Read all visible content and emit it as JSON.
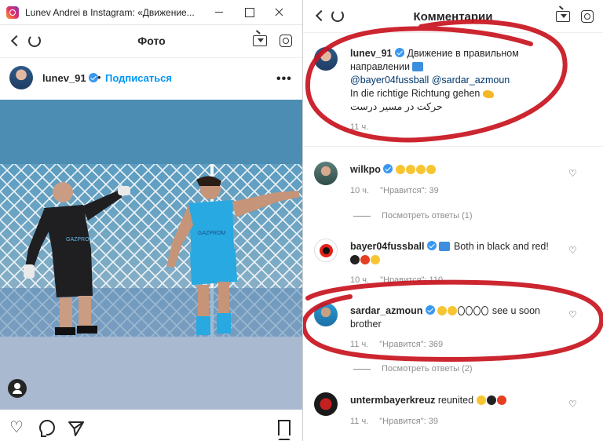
{
  "left_window": {
    "title": "Lunev Andrei в Instagram: «Движение...",
    "nav_title": "Фото",
    "post": {
      "username": "lunev_91",
      "follow_label": "Подписаться",
      "more_label": "•••",
      "photo_sign": "GAZPROM"
    }
  },
  "right_window": {
    "nav_title": "Комментарии",
    "caption": {
      "username": "lunev_91",
      "line1": " Движение в правильном направлении",
      "line2": "@bayer04fussball @sardar_azmoun",
      "line3": "In die richtige Richtung gehen",
      "line4": "حرکت در مسیر درست",
      "time": "11 ч."
    },
    "comments": [
      {
        "username": "wilkpo",
        "text": "",
        "time": "10 ч.",
        "likes": "\"Нравится\": 39",
        "replies": "Посмотреть ответы (1)"
      },
      {
        "username": "bayer04fussball",
        "text": " Both in black and red!",
        "time": "10 ч.",
        "likes": "\"Нравится\": 110",
        "replies": ""
      },
      {
        "username": "sardar_azmoun",
        "text": " see u soon",
        "text2": "brother",
        "time": "11 ч.",
        "likes": "\"Нравится\": 369",
        "replies": "Посмотреть ответы (2)"
      },
      {
        "username": "untermbayerkreuz",
        "text": " reunited",
        "time": "11 ч.",
        "likes": "\"Нравится\": 39",
        "replies": ""
      }
    ]
  },
  "icons": [
    "instagram-app-icon",
    "back-icon",
    "reload-icon",
    "igtv-icon",
    "instagram-icon",
    "verified-icon",
    "heart-icon",
    "comment-icon",
    "share-icon",
    "bookmark-icon",
    "user-tag-icon"
  ],
  "colors": {
    "link_blue": "#0095f6",
    "verified_blue": "#3897f0",
    "scribble_red": "#c8141e",
    "meta_gray": "#8e8e8e"
  }
}
